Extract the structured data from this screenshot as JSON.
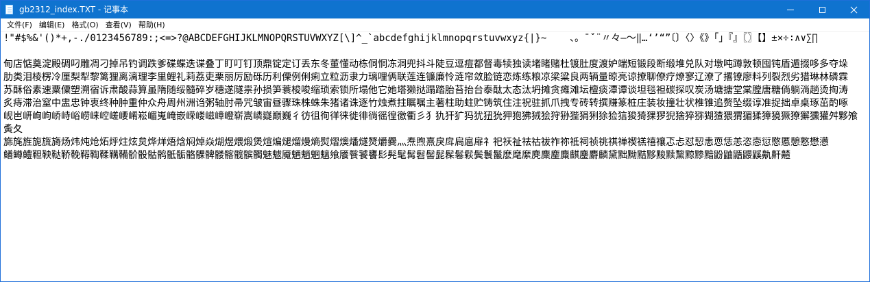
{
  "window": {
    "title": "gb2312_index.TXT - 记事本",
    "controls": {
      "minimize": "minimize",
      "maximize": "maximize",
      "close": "close"
    }
  },
  "menubar": {
    "items": [
      {
        "label": "文件(F)"
      },
      {
        "label": "编辑(E)"
      },
      {
        "label": "格式(O)"
      },
      {
        "label": "查看(V)"
      },
      {
        "label": "帮助(H)"
      }
    ]
  },
  "editor": {
    "content": "!\"#$%&'()*+,-./0123456789:;<=>?@ABCDEFGHIJKLMNOPQRSTUVWXYZ[\\]^_`abcdefghijklmnopqrstuvwxyz{|}~    、。ˉˇ¨〃々—～‖…‘’“”〔〕〈〉《》「」『』〖〗【】±×÷∶∧∨∑∏\n\n甸店惦奠淀殿碉叼雕凋刁掉吊钓调跌爹碟蝶迭谍叠丁盯叮钉顶鼎锭定订丢东冬董懂动栋侗恫冻洞兜抖斗陡豆逗痘都督毒犊独读堵睹赌杜镀肚度渡妒端短锻段断缎堆兑队对墩吨蹲敦顿囤钝盾遁掇哆多夺垛\n肋类泪棱楞冷厘梨犁黎篱狸离漓理李里鲤礼莉荔吏栗丽厉励砾历利傈例俐痢立粒沥隶力璃哩俩联莲连镰廉怜涟帘敛脸链恋炼练粮凉梁粱良两辆量晾亮谅撩聊僚疗燎寥辽潦了撂镣廖料列裂烈劣猎琳林磷霖\n苏酥俗素速粟僳塑溯宿诉肃酸蒜算虽隋随绥髓碎岁穗遂隧祟孙损笋蓑梭唆缩琐索锁所塌他它她塔獭挞蹋踏胎苔抬台泰酞太态汰坍摊贪瘫滩坛檀痰潭谭谈坦毯袒碳探叹炭汤塘搪堂棠膛唐糖倘躺淌趟烫掏涛\n炙痔滞治窒中盅忠钟衷终种肿重仲众舟周州洲诌粥轴肘帚咒皱宙昼骤珠株蛛朱猪诸诛逐竹烛煮拄瞩嘱主著柱助蛀贮铸筑住注祝驻抓爪拽专砖转撰赚篆桩庄装妆撞壮状椎锥追赘坠缀谆准捉拙卓桌琢茁酌啄\n岘岜岍峋岣峤峙峪崂崃崆嵯崾崤崧嵋嵬崦嵌嵘嵝嵫嶂嶝崭嵩嶙嶷巅巍彳彷徂徇徉徕徙徘徜徭徨徼衢彡犭犰犴犷犸犹狃狁狎狍狒狨狯狩狲狴狷猁狳猃狺狻猗猓猡猊猞猝猕猢猹猥猬猸猱獐獍獗獠獬獯獾舛夥飧夤夂\n旆旄旌旎旒旖炀炜炖炝炻烀炷炫炱烨烊焐焓焖焯焱煳煜煨煅煲煊煸煺熘熳熵熨熠燠燔燧燹爝爨灬焘煦熹戾戽扃扈扉礻祀祆祉祛祜祓祚祢祗祠祯祧祺禅禊禚禧禳忑忐怼恝恚恧恁恙恣悫愆愍慝憩憝懋懑\n鳝鳟鳢靼鞅鞑鞒鞔鞯鞫鞣鞲鞴骱骰骷鹘骶骺骼髁髀髅髂髋髌髑魅魃魇魉魈魍魑飨餍餮饕饔髟髡髦髯髫髻髭髹鬈鬏鬓鬟鬣麽麾縻麂麇麈麋麒鏖麝麟黛黜黝黠黟黢黩黧黥黪黯鼢鼬鼯鼹鼷鼽鼾齄"
  }
}
